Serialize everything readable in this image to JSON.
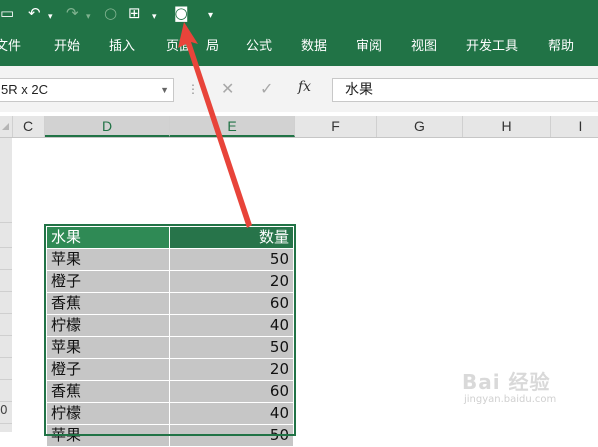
{
  "quick_access": {
    "icons": [
      "save-icon",
      "undo-icon",
      "redo-icon",
      "circle-icon",
      "format-painter-icon",
      "camera-icon",
      "customize-icon"
    ]
  },
  "ribbon": {
    "tabs": [
      "文件",
      "开始",
      "插入",
      "页面布局",
      "公式",
      "数据",
      "审阅",
      "视图",
      "开发工具",
      "帮助"
    ],
    "tab_fragments": [
      "页面",
      "局"
    ]
  },
  "formula_bar": {
    "name_box": "5R x 2C",
    "fx_label": "fx",
    "formula_value": "水果"
  },
  "columns": [
    "C",
    "D",
    "E",
    "F",
    "G",
    "H",
    "I"
  ],
  "row_number_partial": "0",
  "table": {
    "headers": [
      "水果",
      "数量"
    ],
    "rows": [
      [
        "苹果",
        "50"
      ],
      [
        "橙子",
        "20"
      ],
      [
        "香蕉",
        "60"
      ],
      [
        "柠檬",
        "40"
      ],
      [
        "苹果",
        "50"
      ],
      [
        "橙子",
        "20"
      ],
      [
        "香蕉",
        "60"
      ],
      [
        "柠檬",
        "40"
      ],
      [
        "苹果",
        "50"
      ]
    ]
  },
  "watermark": {
    "main": "Bai 经验",
    "sub": "jingyan.baidu.com"
  },
  "colors": {
    "excel_green": "#217346",
    "header_fill": "#2f8a55",
    "cell_fill": "#c6c6c6",
    "arrow": "#e8443a"
  }
}
